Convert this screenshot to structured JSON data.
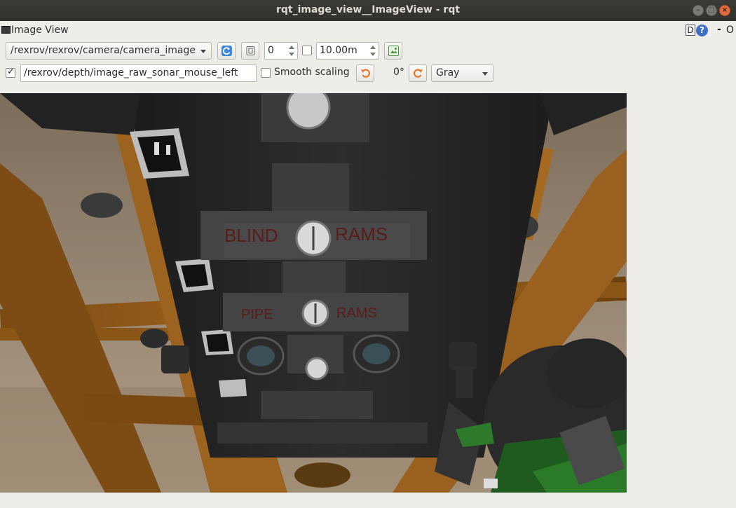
{
  "window": {
    "title": "rqt_image_view__ImageView - rqt",
    "buttons": {
      "minimize": "–",
      "maximize": "□",
      "close": "×"
    }
  },
  "dock": {
    "title": "Image View",
    "d_label": "D",
    "help_label": "?",
    "dash_label": "-",
    "o_label": "O"
  },
  "toolbar": {
    "topic": "/rexrov/rexrov/camera/camera_image",
    "frame_value": "0",
    "timeout_value": "10.00m",
    "mouse_checked": true,
    "mouse_topic": "/rexrov/depth/image_raw_sonar_mouse_left",
    "smooth_scaling_label": "Smooth scaling",
    "rotation_label": "0°",
    "color_scheme": "Gray"
  },
  "image": {
    "panel_text_top_left": "BLIND",
    "panel_text_top_right": "RAMS",
    "panel_text_bottom_left": "PIPE",
    "panel_text_bottom_right": "RAMS"
  },
  "colors": {
    "titlebar": "#3c3b37",
    "window_bg": "#efedea",
    "close_button": "#e06b3e",
    "refresh_icon": "#3b86d8",
    "rotate_icon": "#e8782b",
    "save_icon": "#4b9a3a"
  }
}
